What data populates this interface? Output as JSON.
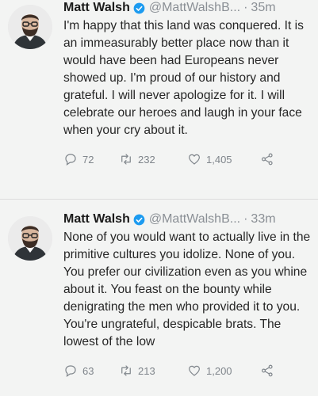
{
  "tweets": [
    {
      "name": "Matt Walsh",
      "handle": "@MattWalshB...",
      "separator": "·",
      "time": "35m",
      "text": "I'm happy that this land was conquered. It is an immeasurably better place now than it would have been had Europeans never showed up. I'm proud of our history and grateful. I will never apologize for it. I will celebrate our heroes and laugh in your face when your cry about it.",
      "replies": "72",
      "retweets": "232",
      "likes": "1,405"
    },
    {
      "name": "Matt Walsh",
      "handle": "@MattWalshB...",
      "separator": "·",
      "time": "33m",
      "text": "None of you would want to actually live in the primitive cultures you idolize. None of you. You prefer our civilization even as you whine about it. You feast on the bounty while denigrating the men who provided it to you. You're ungrateful, despicable brats. The lowest of the low",
      "replies": "63",
      "retweets": "213",
      "likes": "1,200"
    }
  ],
  "colors": {
    "verified": "#1d9bf0",
    "muted": "#8a8f95",
    "text": "#262626",
    "background": "#f3f4f3"
  },
  "icons": [
    "avatar",
    "verified-badge-icon",
    "reply-icon",
    "retweet-icon",
    "like-icon",
    "share-icon"
  ]
}
